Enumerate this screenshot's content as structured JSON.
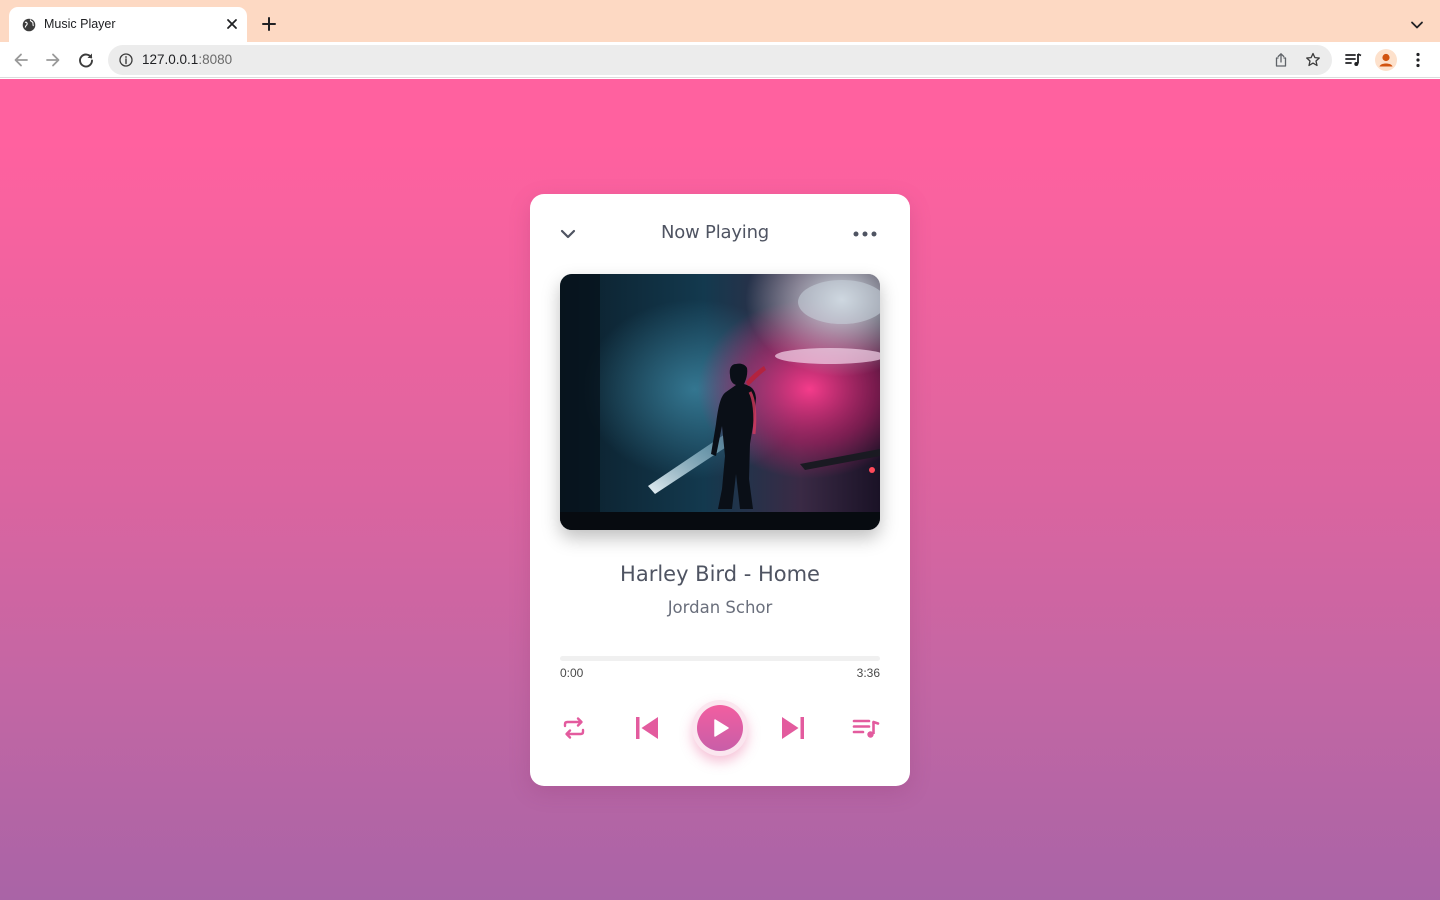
{
  "browser": {
    "tab_title": "Music Player",
    "url_host": "127.0.0.1",
    "url_port": ":8080"
  },
  "player": {
    "header_title": "Now Playing",
    "song_title": "Harley Bird - Home",
    "artist": "Jordan Schor",
    "time_current": "0:00",
    "time_total": "3:36",
    "progress_fraction": 0,
    "accent_color": "#e35b9e",
    "page_gradient_top": "#ff619f",
    "page_gradient_bottom": "#a964a6",
    "icons": {
      "header_left": "chevron-down-icon",
      "header_right": "more-horizontal-icon",
      "repeat": "repeat-icon",
      "previous": "skip-previous-icon",
      "play": "play-icon",
      "next": "skip-next-icon",
      "playlist": "playlist-icon"
    }
  }
}
